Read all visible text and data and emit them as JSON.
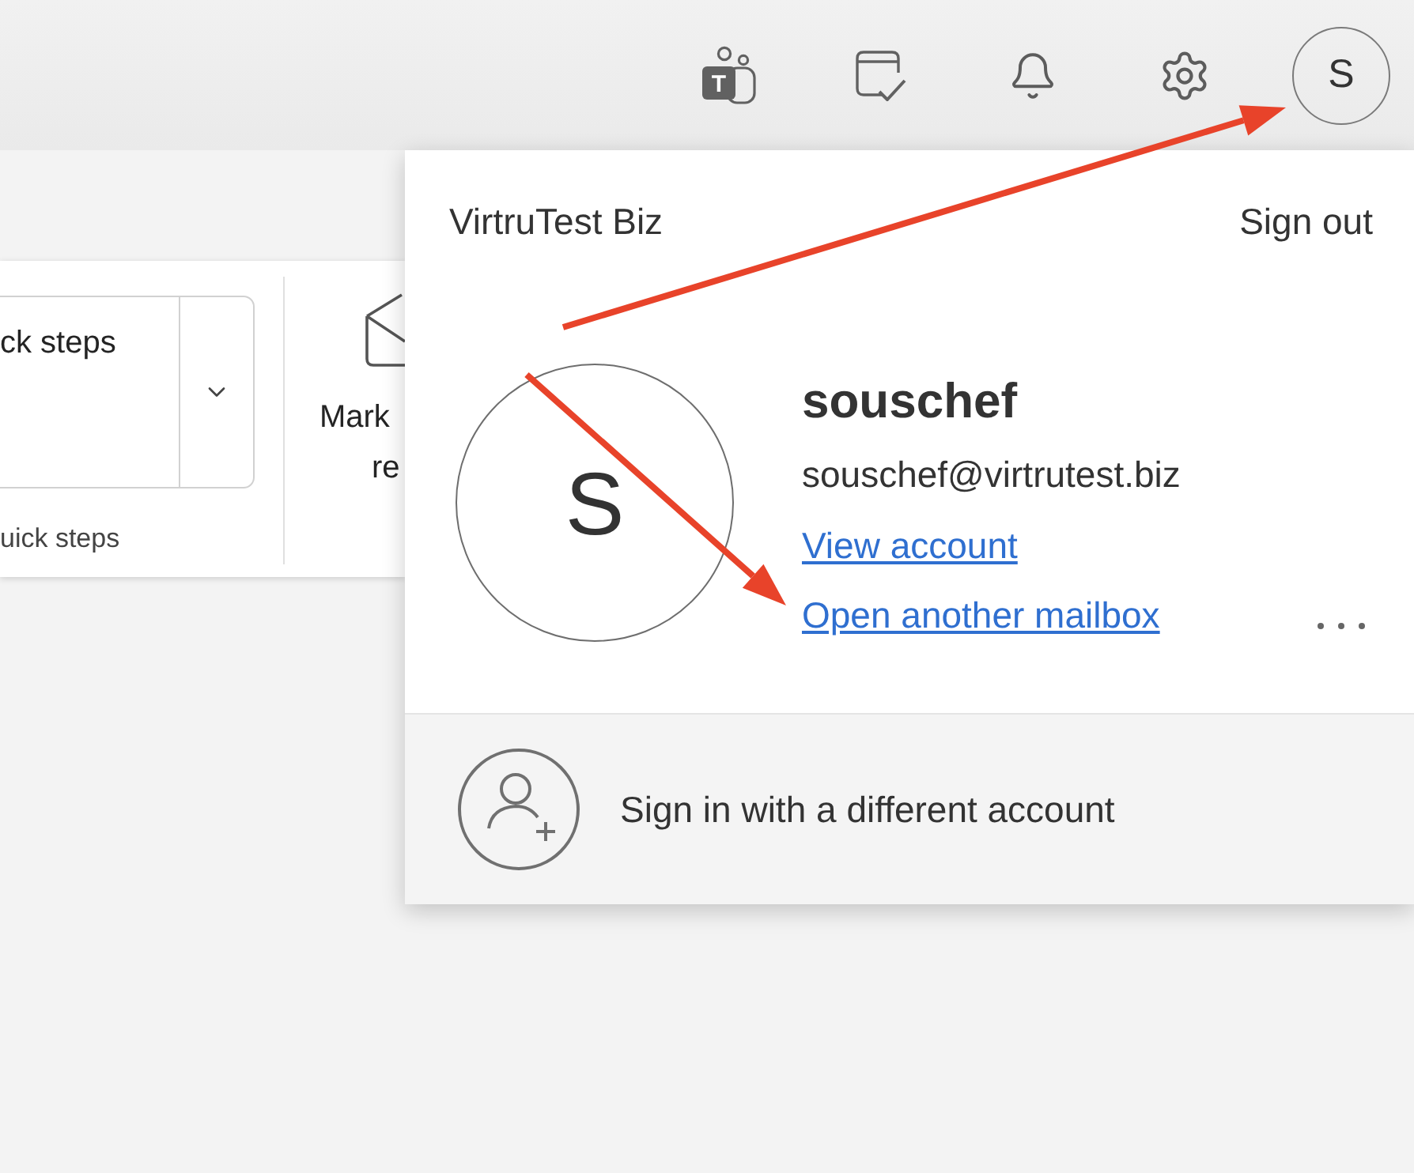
{
  "top_bar": {
    "teams_letter": "T",
    "avatar_initial": "S"
  },
  "ribbon": {
    "quick_steps": {
      "label": "ck steps",
      "group_label": "uick steps"
    },
    "mark_read": {
      "label_lines": [
        "Mark",
        "re"
      ]
    }
  },
  "account_menu": {
    "organization": "VirtruTest Biz",
    "sign_out": "Sign out",
    "avatar_initial": "S",
    "display_name": "souschef",
    "email": "souschef@virtrutest.biz",
    "links": [
      "View account",
      "Open another mailbox"
    ],
    "other_account": "Sign in with a different account"
  }
}
